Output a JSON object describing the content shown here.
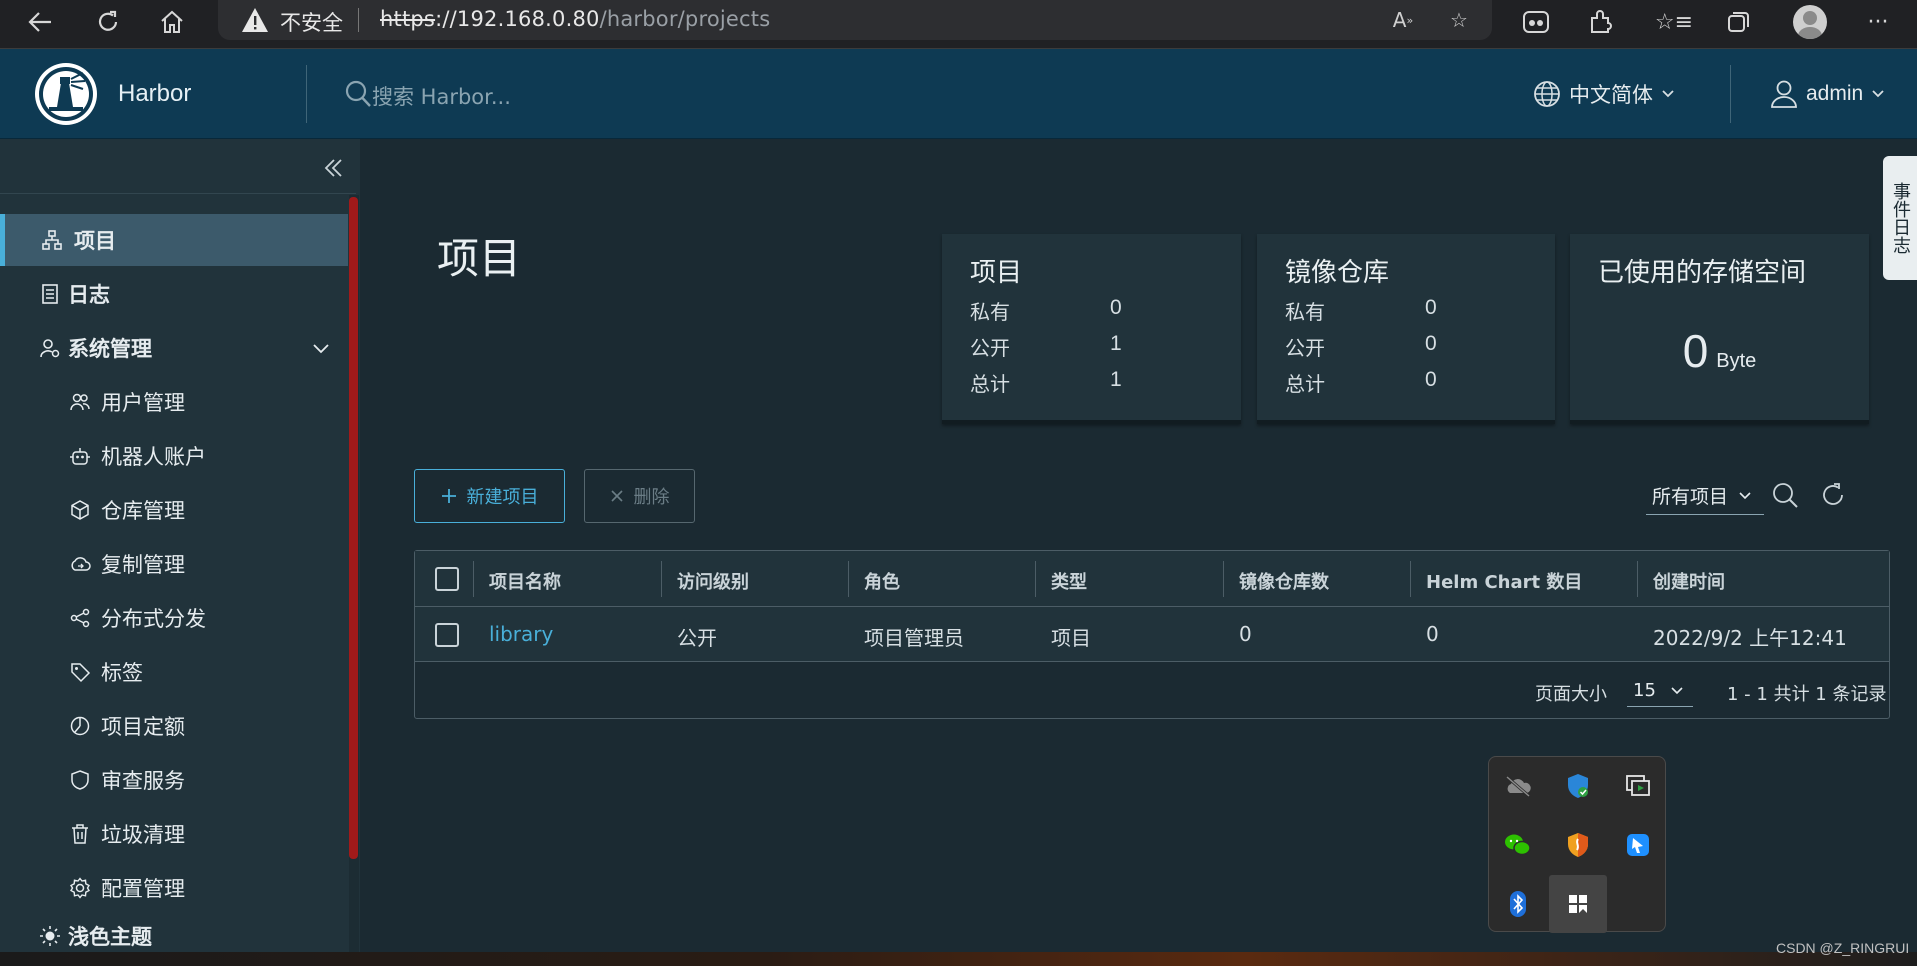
{
  "browser": {
    "security_label": "不安全",
    "url_scheme": "https",
    "url_rest": "://192.168.0.80",
    "url_path": "/harbor/projects"
  },
  "header": {
    "brand": "Harbor",
    "search_placeholder": "搜索 Harbor...",
    "language": "中文简体",
    "user": "admin"
  },
  "sidebar": {
    "items": [
      {
        "label": "项目",
        "icon": "projects-icon",
        "active": true
      },
      {
        "label": "日志",
        "icon": "logs-icon"
      },
      {
        "label": "系统管理",
        "icon": "admin-icon"
      },
      {
        "label": "用户管理",
        "icon": "users-icon"
      },
      {
        "label": "机器人账户",
        "icon": "robot-icon"
      },
      {
        "label": "仓库管理",
        "icon": "registry-icon"
      },
      {
        "label": "复制管理",
        "icon": "replication-icon"
      },
      {
        "label": "分布式分发",
        "icon": "distribution-icon"
      },
      {
        "label": "标签",
        "icon": "tag-icon"
      },
      {
        "label": "项目定额",
        "icon": "quota-icon"
      },
      {
        "label": "审查服务",
        "icon": "shield-icon"
      },
      {
        "label": "垃圾清理",
        "icon": "trash-icon"
      },
      {
        "label": "配置管理",
        "icon": "gear-icon"
      },
      {
        "label": "浅色主题",
        "icon": "sun-icon"
      }
    ]
  },
  "main": {
    "title": "项目",
    "cards": {
      "projects": {
        "title": "项目",
        "rows": [
          {
            "label": "私有",
            "value": "0"
          },
          {
            "label": "公开",
            "value": "1"
          },
          {
            "label": "总计",
            "value": "1"
          }
        ]
      },
      "repos": {
        "title": "镜像仓库",
        "rows": [
          {
            "label": "私有",
            "value": "0"
          },
          {
            "label": "公开",
            "value": "0"
          },
          {
            "label": "总计",
            "value": "0"
          }
        ]
      },
      "storage": {
        "title": "已使用的存储空间",
        "value": "0",
        "unit": "Byte"
      }
    },
    "buttons": {
      "new_project": "新建项目",
      "delete": "删除"
    },
    "filter": "所有项目",
    "table": {
      "columns": [
        "项目名称",
        "访问级别",
        "角色",
        "类型",
        "镜像仓库数",
        "Helm Chart 数目",
        "创建时间"
      ],
      "rows": [
        {
          "name": "library",
          "access": "公开",
          "role": "项目管理员",
          "type": "项目",
          "repos": "0",
          "charts": "0",
          "created": "2022/9/2 上午12:41"
        }
      ],
      "page_size_label": "页面大小",
      "page_size": "15",
      "count_text": "1 - 1 共计 1 条记录"
    },
    "event_log": "事件日志"
  },
  "watermark": "CSDN @Z_RINGRUI",
  "colors": {
    "accent": "#49afd9",
    "header_bg": "#0e3a53",
    "sidebar_bg": "#21333b",
    "main_bg": "#1b2a32"
  }
}
